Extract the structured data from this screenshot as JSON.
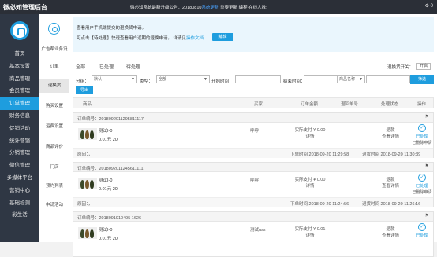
{
  "topbar": {
    "brand": "微必知管理后台",
    "notice_prefix": "微必知系统最新升级公告：20180810",
    "notice_link": "系统更新",
    "notice_rest": "重要更新",
    "user": "编程 在线人数:",
    "gear": "⚙ 0"
  },
  "sidebar": {
    "items": [
      {
        "label": "首页"
      },
      {
        "label": "基本设置"
      },
      {
        "label": "商品管理"
      },
      {
        "label": "会员管理"
      },
      {
        "label": "订单管理",
        "active": true
      },
      {
        "label": "财务信息"
      },
      {
        "label": "促销活动"
      },
      {
        "label": "统计营销"
      },
      {
        "label": "分销管理"
      },
      {
        "label": "微信管理"
      },
      {
        "label": "多媒体平台"
      },
      {
        "label": "营销中心"
      },
      {
        "label": "基础检测"
      },
      {
        "label": "彩生活"
      }
    ]
  },
  "subnav": {
    "title": "广告帮业务设",
    "items": [
      {
        "label": "订单"
      },
      {
        "label": "退换货",
        "active": true
      },
      {
        "label": "购买设置"
      },
      {
        "label": "运费设置"
      },
      {
        "label": "商品评价"
      },
      {
        "label": "门店"
      },
      {
        "label": "预约列表"
      },
      {
        "label": "申请活动"
      }
    ]
  },
  "tip": {
    "line1": "查看用户手机端提交的退换货申请。",
    "line2_prefix": "可点击【待处理】快速查看用户近期的退换申请。 详请见",
    "line2_link": "操作文档",
    "button": "编辑"
  },
  "tabs": {
    "items": [
      "全部",
      "已处理",
      "待处理"
    ],
    "toggle_label": "退换货开关：",
    "toggle_value": "开启"
  },
  "filter": {
    "cat_label": "分组：",
    "cat_value": "默认",
    "type_label": "类型：",
    "type_value": "全部",
    "start_label": "开始时间：",
    "end_label": "结束时间：",
    "field_value": "商品名称",
    "search_btn": "筛选"
  },
  "export_label": "导出",
  "table_headers": [
    "商品",
    "买家",
    "订单金额",
    "退回单号",
    "处理状态",
    "操作"
  ],
  "orders": [
    {
      "order_no": "订单编号：2018092011295811117",
      "product": "测试I-0",
      "price": "0.01元 20",
      "buyer": "呼呼",
      "paid": "实际支付 ¥ 0.00",
      "detail": "详情",
      "status": "退款",
      "status_detail": "查看详情",
      "op_a": "已处理",
      "op_b": "已删除申请",
      "remark": "原因：，",
      "order_time": "下单时间 2018-09-20 11:29:58",
      "refund_time": "退货时间 2018-09-20 11:30:39"
    },
    {
      "order_no": "订单编号：2018092011245611111",
      "product": "测试I-0",
      "price": "0.01元 20",
      "buyer": "呼呼",
      "paid": "实际支付 ¥ 0.00",
      "detail": "详情",
      "status": "退款",
      "status_detail": "查看详情",
      "op_a": "已处理",
      "op_b": "已删除申请",
      "remark": "原因：，",
      "order_time": "下单时间 2018-09-20 11:24:56",
      "refund_time": "退货时间 2018-09-20 11:26:16"
    },
    {
      "order_no": "订单编号：2018091910495 1626",
      "product": "测试I-0",
      "price": "0.01元 20",
      "buyer": "测试uss",
      "paid": "实际支付 ¥ 0.01",
      "detail": "详情",
      "status": "退款",
      "status_detail": "查看详情",
      "op_a": "已处理",
      "op_b": "",
      "remark": "",
      "order_time": "",
      "refund_time": ""
    }
  ],
  "colors": {
    "accent": "#1e9dde",
    "sidebar_bg": "#2f3744",
    "topbar_bg": "#2b2f37"
  }
}
